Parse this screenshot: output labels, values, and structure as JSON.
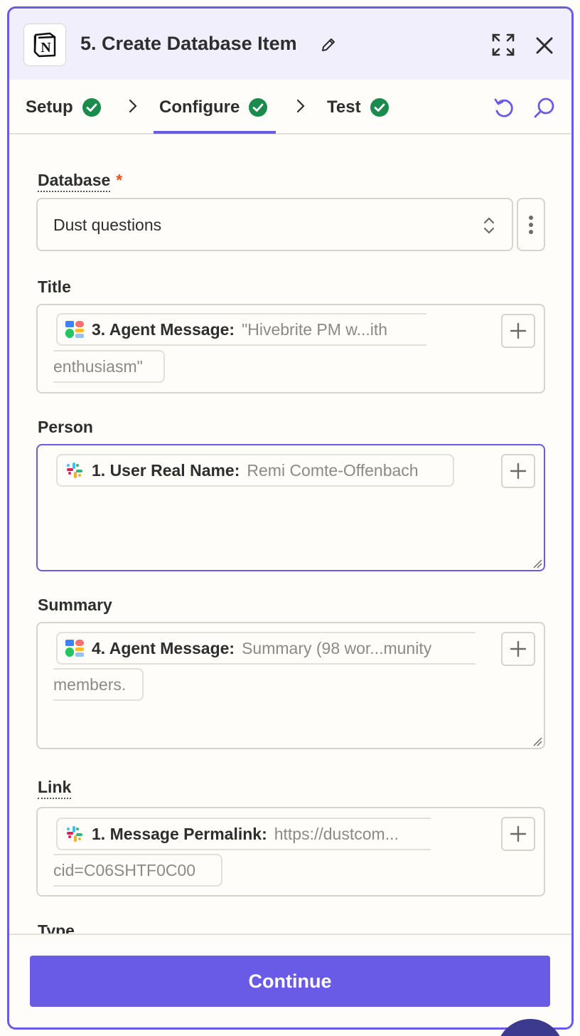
{
  "header": {
    "app_icon": "notion-icon",
    "title": "5. Create Database Item"
  },
  "tabs": [
    {
      "label": "Setup",
      "status": "complete"
    },
    {
      "label": "Configure",
      "status": "complete",
      "active": true
    },
    {
      "label": "Test",
      "status": "complete"
    }
  ],
  "fields": {
    "database": {
      "label": "Database",
      "required_mark": "*",
      "value": "Dust questions"
    },
    "title": {
      "label": "Title",
      "pill_label": "3. Agent Message:",
      "pill_value": "\"Hivebrite PM w...ith",
      "pill_value_cont": "enthusiasm\"",
      "icon": "dust-icon"
    },
    "person": {
      "label": "Person",
      "pill_label": "1. User Real Name:",
      "pill_value": "Remi Comte-Offenbach",
      "icon": "slack-icon"
    },
    "summary": {
      "label": "Summary",
      "pill_label": "4. Agent Message:",
      "pill_value": "Summary (98 wor...munity",
      "pill_value_cont": "members.",
      "icon": "dust-icon"
    },
    "link": {
      "label": "Link",
      "pill_label": "1. Message Permalink:",
      "pill_value": "https://dustcom...",
      "pill_value_cont": "cid=C06SHTF0C00",
      "icon": "slack-icon"
    },
    "type": {
      "label": "Type"
    }
  },
  "footer": {
    "continue_label": "Continue"
  },
  "colors": {
    "accent": "#695be6",
    "success": "#1a8a4d",
    "required": "#e5541f",
    "header_bg": "#f1effc"
  }
}
